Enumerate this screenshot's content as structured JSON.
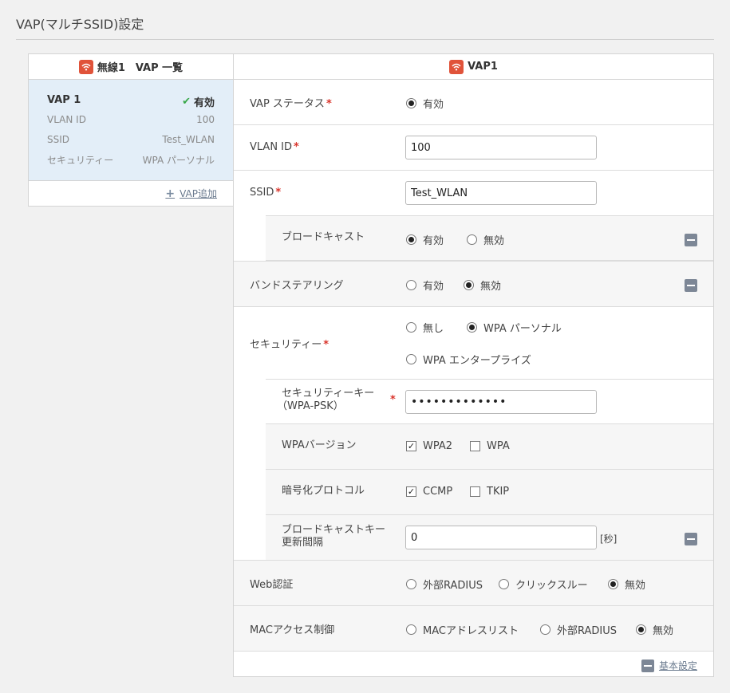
{
  "page_title": "VAP(マルチSSID)設定",
  "left": {
    "header": "無線1　VAP 一覧",
    "card": {
      "name": "VAP 1",
      "status": "有効",
      "rows": [
        {
          "key": "VLAN ID",
          "value": "100"
        },
        {
          "key": "SSID",
          "value": "Test_WLAN"
        },
        {
          "key": "セキュリティー",
          "value": "WPA パーソナル"
        }
      ]
    },
    "add_label": "VAP追加"
  },
  "right": {
    "header": "VAP1",
    "vap_status": {
      "label": "VAP ステータス",
      "option": "有効"
    },
    "vlan_id": {
      "label": "VLAN ID",
      "value": "100"
    },
    "ssid": {
      "label": "SSID",
      "value": "Test_WLAN"
    },
    "broadcast": {
      "label": "ブロードキャスト",
      "options": [
        "有効",
        "無効"
      ],
      "selected": "有効"
    },
    "band_steering": {
      "label": "バンドステアリング",
      "options": [
        "有効",
        "無効"
      ],
      "selected": "無効"
    },
    "security": {
      "label": "セキュリティー",
      "options": [
        "無し",
        "WPA パーソナル",
        "WPA エンタープライズ"
      ],
      "selected": "WPA パーソナル"
    },
    "security_key": {
      "label1": "セキュリティーキー",
      "label2": "（WPA-PSK）",
      "value": "•••••••••••••"
    },
    "wpa_version": {
      "label": "WPAバージョン",
      "options": [
        "WPA2",
        "WPA"
      ],
      "checked": [
        "WPA2"
      ]
    },
    "encryption": {
      "label": "暗号化プロトコル",
      "options": [
        "CCMP",
        "TKIP"
      ],
      "checked": [
        "CCMP"
      ]
    },
    "broadcast_key": {
      "label1": "ブロードキャストキー",
      "label2": "更新間隔",
      "value": "0",
      "unit": "[秒]"
    },
    "web_auth": {
      "label": "Web認証",
      "options": [
        "外部RADIUS",
        "クリックスルー",
        "無効"
      ],
      "selected": "無効"
    },
    "mac_access": {
      "label": "MACアクセス制御",
      "options": [
        "MACアドレスリスト",
        "外部RADIUS",
        "無効"
      ],
      "selected": "無効"
    },
    "basic_settings_label": "基本設定"
  },
  "colors": {
    "accent_red": "#e0533a",
    "required": "#d9342b",
    "selected_bg": "#e3eef8",
    "check_green": "#3aa84a"
  }
}
